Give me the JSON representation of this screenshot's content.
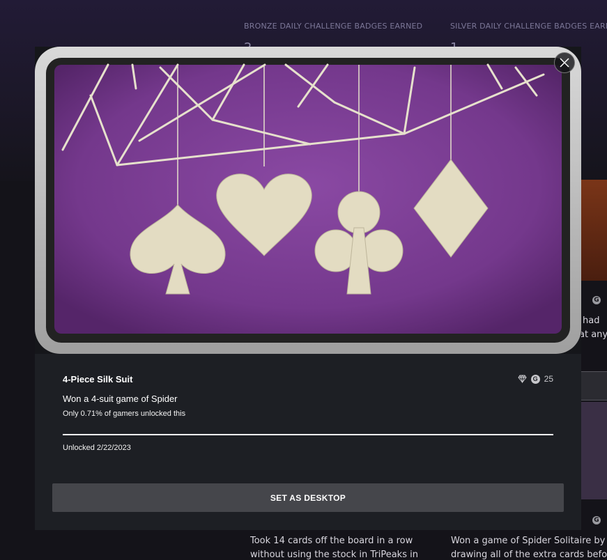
{
  "background": {
    "stats": [
      {
        "label": "BRONZE DAILY CHALLENGE BADGES EARNED",
        "value": "2"
      },
      {
        "label": "SILVER DAILY CHALLENGE BADGES EARNED",
        "value": "1"
      }
    ],
    "partial_texts": {
      "card_right_line1": "had",
      "card_right_line2": "at any",
      "bottom_left_line1": "Took 14 cards off the board in a row",
      "bottom_left_line2": "without using the stock in TriPeaks in",
      "bottom_right_line1": "Won a game of Spider Solitaire by fi",
      "bottom_right_line2": "drawing all of the extra cards before"
    }
  },
  "modal": {
    "achievement": {
      "title": "4-Piece Silk Suit",
      "description": "Won a 4-suit game of Spider",
      "rarity": "Only 0.71% of gamers unlocked this",
      "gamerscore": "25",
      "gamerscore_icon_letter": "G",
      "unlocked": "Unlocked 2/22/2023",
      "icons": [
        "diamond-rarity-icon",
        "gamerscore-icon"
      ]
    },
    "button_label": "SET AS DESKTOP",
    "close_icon": "close-icon",
    "art_colors": {
      "felt": "#7c3d94",
      "frame": "#bdbdbd",
      "suits": "#e3dcc2"
    }
  }
}
